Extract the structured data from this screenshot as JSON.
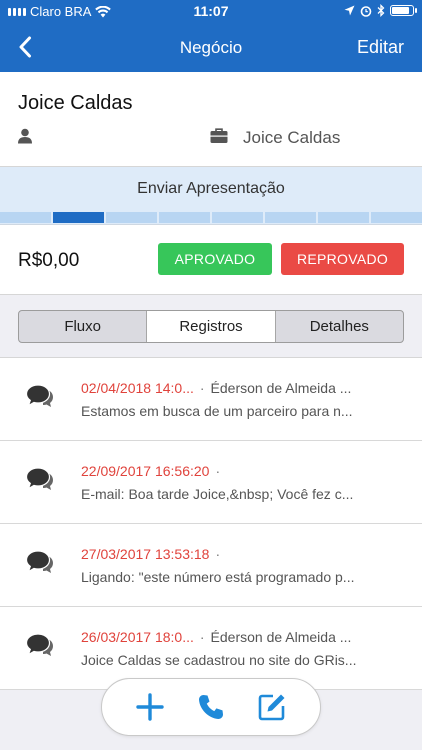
{
  "status_bar": {
    "carrier": "Claro BRA",
    "time": "11:07",
    "battery_level": 0.9,
    "icons": [
      "signal-icon",
      "wifi-icon",
      "location-icon",
      "alarm-icon",
      "bluetooth-icon",
      "battery-icon"
    ]
  },
  "nav": {
    "title": "Negócio",
    "edit_label": "Editar",
    "back_icon": "chevron-left-icon"
  },
  "deal": {
    "contact_name": "Joice Caldas",
    "company_name": "Joice Caldas",
    "stage_label": "Enviar Apresentação",
    "stage_total": 8,
    "stage_current": 2,
    "value": "R$0,00",
    "approve_label": "APROVADO",
    "reject_label": "REPROVADO"
  },
  "tabs": [
    {
      "label": "Fluxo",
      "selected": false
    },
    {
      "label": "Registros",
      "selected": true
    },
    {
      "label": "Detalhes",
      "selected": false
    }
  ],
  "records": [
    {
      "date": "02/04/2018 14:0...",
      "author": "Éderson de Almeida ...",
      "text": "Estamos em busca de um parceiro para n..."
    },
    {
      "date": "22/09/2017 16:56:20",
      "author": "",
      "text": "E-mail: Boa tarde Joice,&nbsp;  Você fez c..."
    },
    {
      "date": "27/03/2017 13:53:18",
      "author": "",
      "text": "Ligando: \"este número está programado p..."
    },
    {
      "date": "26/03/2017 18:0...",
      "author": "Éderson de Almeida ...",
      "text": "Joice Caldas se cadastrou no site do GRis..."
    }
  ],
  "actions": [
    "add-icon",
    "phone-icon",
    "edit-icon"
  ],
  "colors": {
    "brand_blue": "#1f6cc4",
    "approve_green": "#37c65a",
    "reject_red": "#ea4a45",
    "date_red": "#e0433c"
  }
}
